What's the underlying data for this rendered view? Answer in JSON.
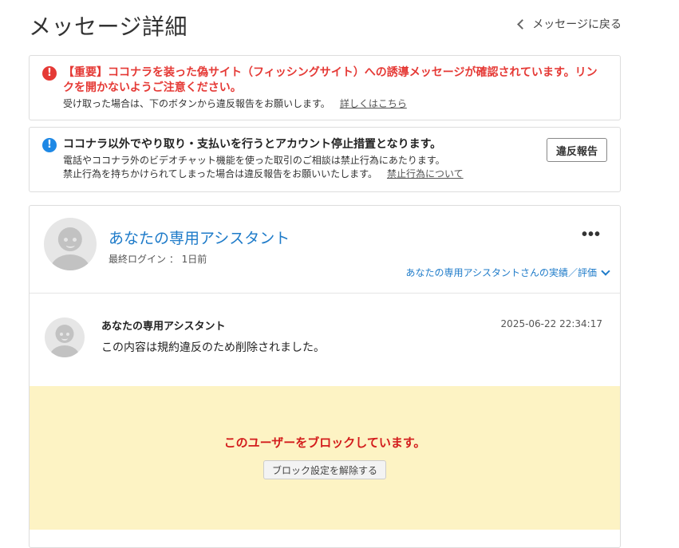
{
  "page": {
    "title": "メッセージ詳細",
    "back_label": "メッセージに戻る"
  },
  "notices": {
    "important": {
      "icon": "exclamation-icon",
      "title": "【重要】ココナラを装った偽サイト（フィッシングサイト）への誘導メッセージが確認されています。リンクを開かないようご注意ください。",
      "text": "受け取った場合は、下のボタンから違反報告をお願いします。",
      "link": "詳しくはこちら"
    },
    "info": {
      "icon": "info-icon",
      "title": "ココナラ以外でやり取り・支払いを行うとアカウント停止措置となります。",
      "line1": "電話やココナラ外のビデオチャット機能を使った取引のご相談は禁止行為にあたります。",
      "line2": "禁止行為を持ちかけられてしまった場合は違反報告をお願いいたします。",
      "link": "禁止行為について",
      "button": "違反報告"
    }
  },
  "profile": {
    "name": "あなたの専用アシスタント",
    "last_login": "最終ログイン ： 1日前",
    "more": "•••",
    "record_link": "あなたの専用アシスタントさんの実績／評価"
  },
  "message": {
    "sender": "あなたの専用アシスタント",
    "timestamp": "2025-06-22 22:34:17",
    "body": "この内容は規約違反のため削除されました。"
  },
  "blocked": {
    "text": "このユーザーをブロックしています。",
    "button": "ブロック設定を解除する"
  },
  "colors": {
    "accent_blue": "#1e7bc9",
    "alert_red": "#e53935",
    "blocked_bg": "#fdf3c4"
  }
}
